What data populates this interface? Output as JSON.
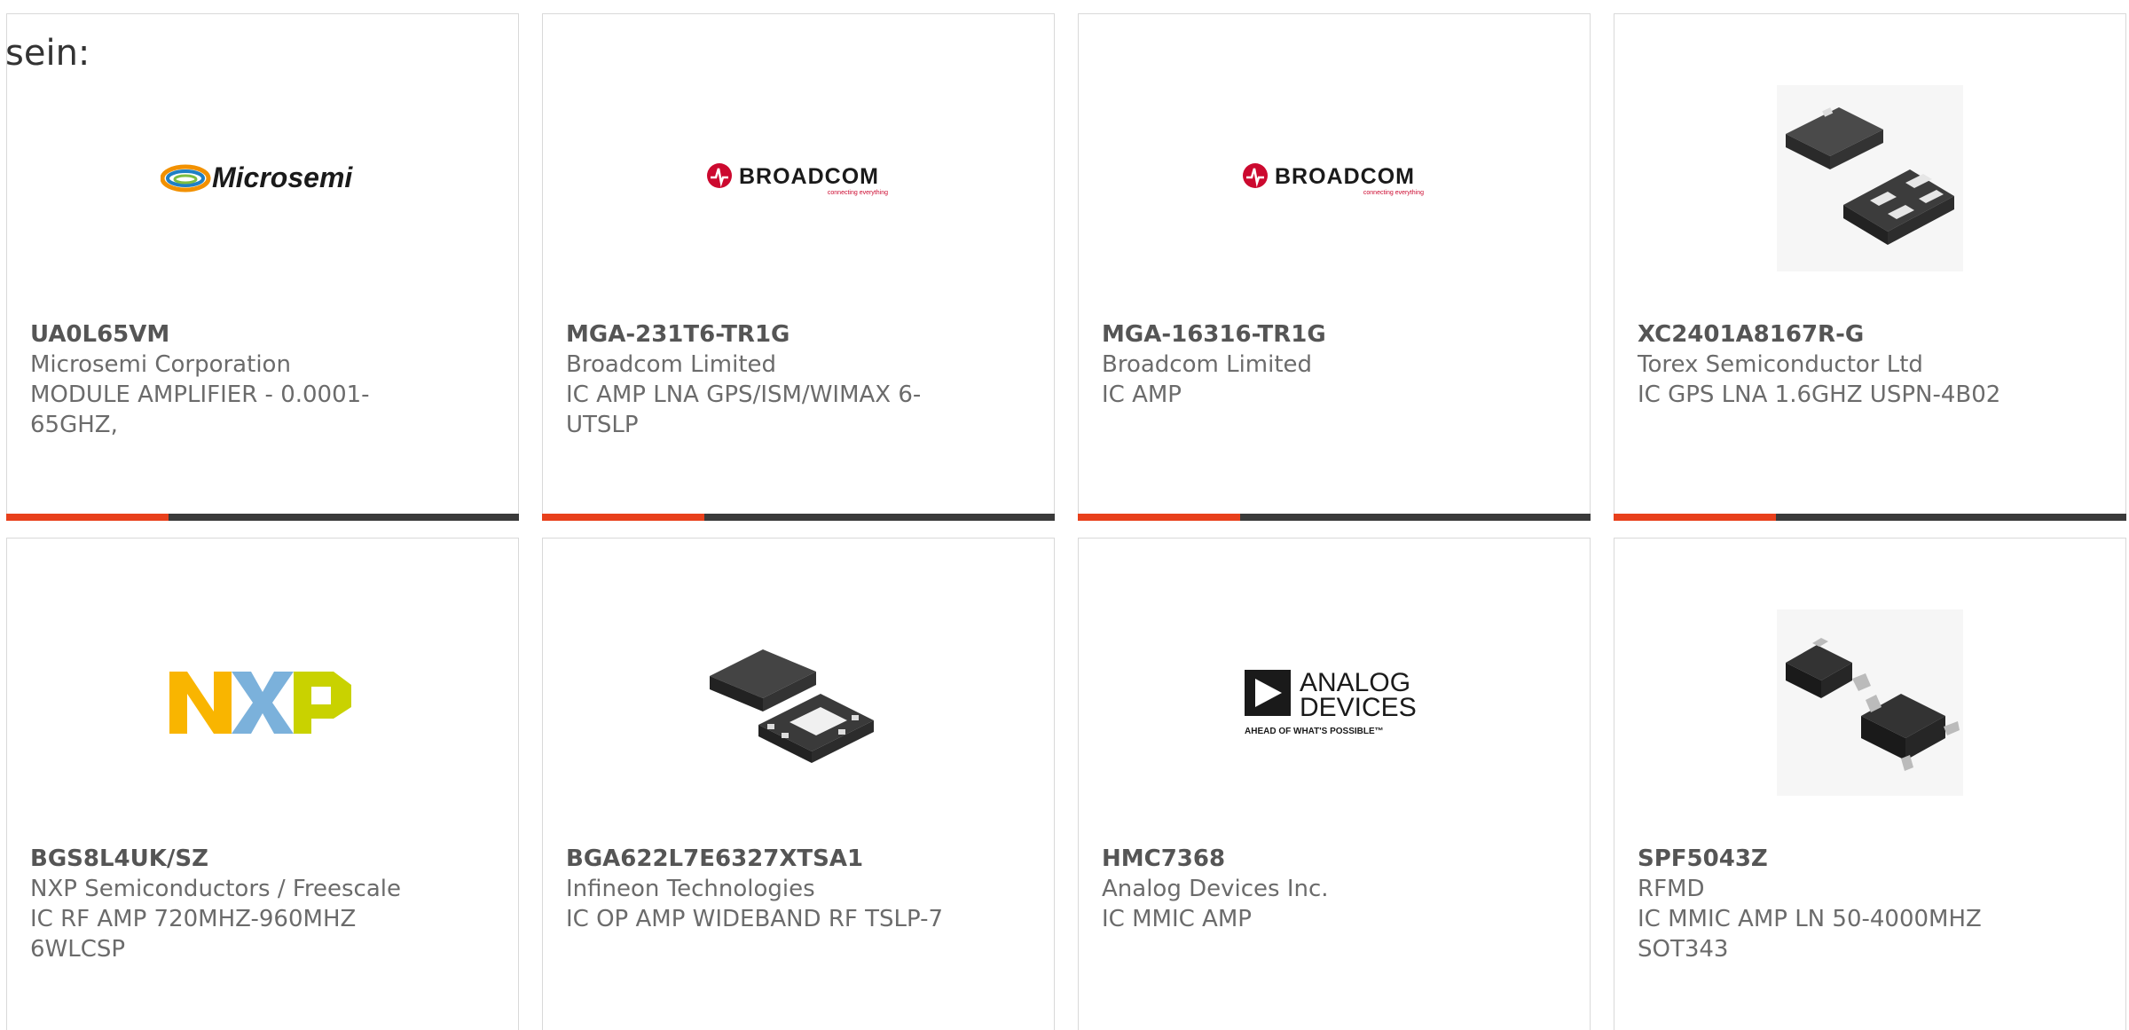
{
  "intro_text": "sein:",
  "products": [
    {
      "part_number": "UA0L65VM",
      "manufacturer": "Microsemi Corporation",
      "description": "MODULE AMPLIFIER - 0.0001-65GHZ,",
      "image": "microsemi-logo",
      "logo_text": "Microsemi"
    },
    {
      "part_number": "MGA-231T6-TR1G",
      "manufacturer": "Broadcom Limited",
      "description": "IC AMP LNA GPS/ISM/WIMAX 6-UTSLP",
      "image": "broadcom-logo",
      "logo_text": "BROADCOM",
      "logo_tagline": "connecting everything"
    },
    {
      "part_number": "MGA-16316-TR1G",
      "manufacturer": "Broadcom Limited",
      "description": "IC AMP",
      "image": "broadcom-logo",
      "logo_text": "BROADCOM",
      "logo_tagline": "connecting everything"
    },
    {
      "part_number": "XC2401A8167R-G",
      "manufacturer": "Torex Semiconductor Ltd",
      "description": "IC GPS LNA 1.6GHZ USPN-4B02",
      "image": "ic-package-photo"
    },
    {
      "part_number": "BGS8L4UK/SZ",
      "manufacturer": "NXP Semiconductors / Freescale",
      "description": "IC RF AMP 720MHZ-960MHZ 6WLCSP",
      "image": "nxp-logo",
      "logo_text": "NXP"
    },
    {
      "part_number": "BGA622L7E6327XTSA1",
      "manufacturer": "Infineon Technologies",
      "description": "IC OP AMP WIDEBAND RF TSLP-7",
      "image": "ic-package-photo"
    },
    {
      "part_number": "HMC7368",
      "manufacturer": "Analog Devices Inc.",
      "description": "IC MMIC AMP",
      "image": "analog-devices-logo",
      "logo_text_line1": "ANALOG",
      "logo_text_line2": "DEVICES",
      "logo_tagline": "AHEAD OF WHAT'S POSSIBLE™"
    },
    {
      "part_number": "SPF5043Z",
      "manufacturer": "RFMD",
      "description": "IC MMIC AMP LN 50-4000MHZ SOT343",
      "image": "ic-package-photo"
    }
  ],
  "colors": {
    "accent": "#e8401c",
    "bar_dark": "#3a3a3a",
    "text": "#6b6b6b",
    "broadcom_red": "#cc092f",
    "nxp_orange": "#f9b500",
    "nxp_blue": "#7bb1db",
    "nxp_green": "#c9d200"
  }
}
